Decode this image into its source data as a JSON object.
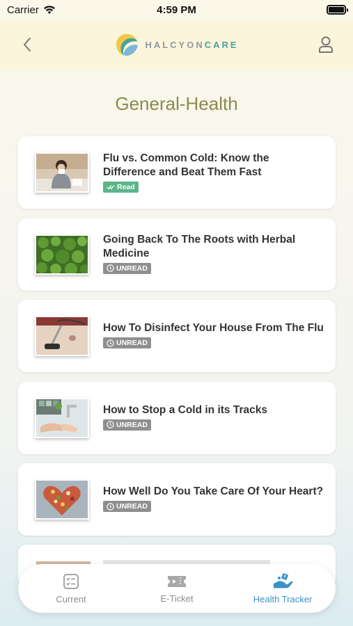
{
  "status_bar": {
    "carrier": "Carrier",
    "time": "4:59 PM"
  },
  "header": {
    "logo_text_part1": "HALCYON",
    "logo_text_part2": "CARE"
  },
  "page_title": "General-Health",
  "articles": [
    {
      "title": "Flu vs. Common Cold: Know the Difference and Beat Them Fast",
      "status": "Read",
      "thumb": "sick-person-icon"
    },
    {
      "title": "Going Back To The Roots with Herbal Medicine",
      "status": "UNREAD",
      "thumb": "herbs-icon"
    },
    {
      "title": "How To Disinfect Your House From The Flu",
      "status": "UNREAD",
      "thumb": "vacuum-icon"
    },
    {
      "title": "How to Stop a Cold in its Tracks",
      "status": "UNREAD",
      "thumb": "handwash-icon"
    },
    {
      "title": "How Well Do You Take Care Of Your Heart?",
      "status": "UNREAD",
      "thumb": "heart-food-icon"
    }
  ],
  "tab_bar": {
    "tabs": [
      {
        "label": "Current",
        "icon": "checklist-icon",
        "active": false
      },
      {
        "label": "E-Ticket",
        "icon": "ticket-icon",
        "active": false
      },
      {
        "label": "Health Tracker",
        "icon": "health-hand-icon",
        "active": true
      }
    ]
  },
  "colors": {
    "header_bg": "#fbf5dc",
    "title_color": "#8a8a4e",
    "read_badge": "#5bb58a",
    "unread_badge": "#8f8f8f",
    "active_tab": "#3a91c6"
  }
}
